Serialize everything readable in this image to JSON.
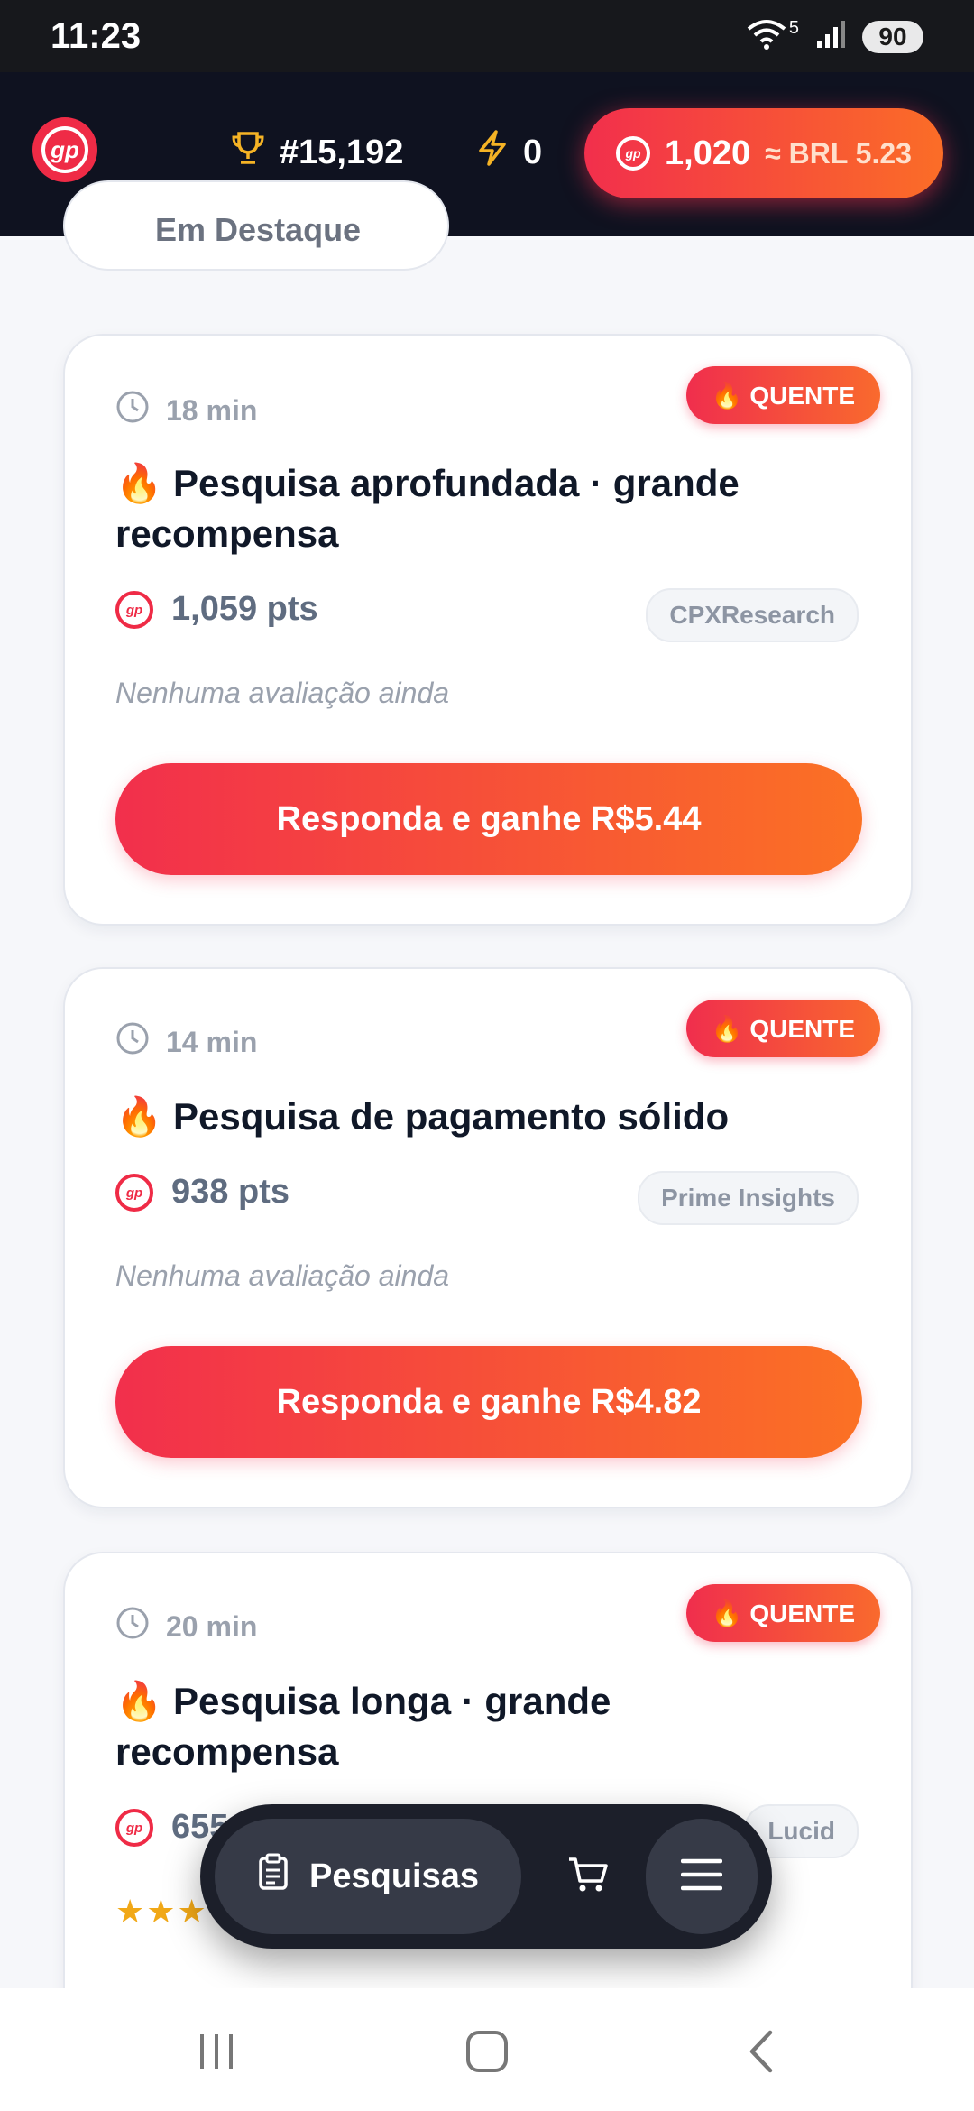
{
  "status_bar": {
    "time": "11:23",
    "network_label": "5",
    "battery": "90"
  },
  "header": {
    "logo_text": "gp",
    "rank": "#15,192",
    "energy": "0",
    "balance_points": "1,020",
    "balance_conversion": "≈ BRL 5.23"
  },
  "filter": {
    "label": "Em Destaque"
  },
  "cards": [
    {
      "duration": "18 min",
      "badge": "🔥 QUENTE",
      "title": "🔥 Pesquisa aprofundada · grande recompensa",
      "points": "1,059 pts",
      "provider": "CPXResearch",
      "rating": "Nenhuma avaliação ainda",
      "cta": "Responda e ganhe R$5.44"
    },
    {
      "duration": "14 min",
      "badge": "🔥 QUENTE",
      "title": "🔥 Pesquisa de pagamento sólido",
      "points": "938 pts",
      "provider": "Prime Insights",
      "rating": "Nenhuma avaliação ainda",
      "cta": "Responda e ganhe R$4.82"
    },
    {
      "duration": "20 min",
      "badge": "🔥 QUENTE",
      "title": "🔥 Pesquisa longa · grande recompensa",
      "points": "655",
      "provider": "Lucid",
      "stars": "★★★"
    }
  ],
  "bottom_nav": {
    "surveys_label": "Pesquisas"
  },
  "colors": {
    "accent_start": "#f22f4c",
    "accent_end": "#fb6d27",
    "header_bg": "#0f1220"
  }
}
